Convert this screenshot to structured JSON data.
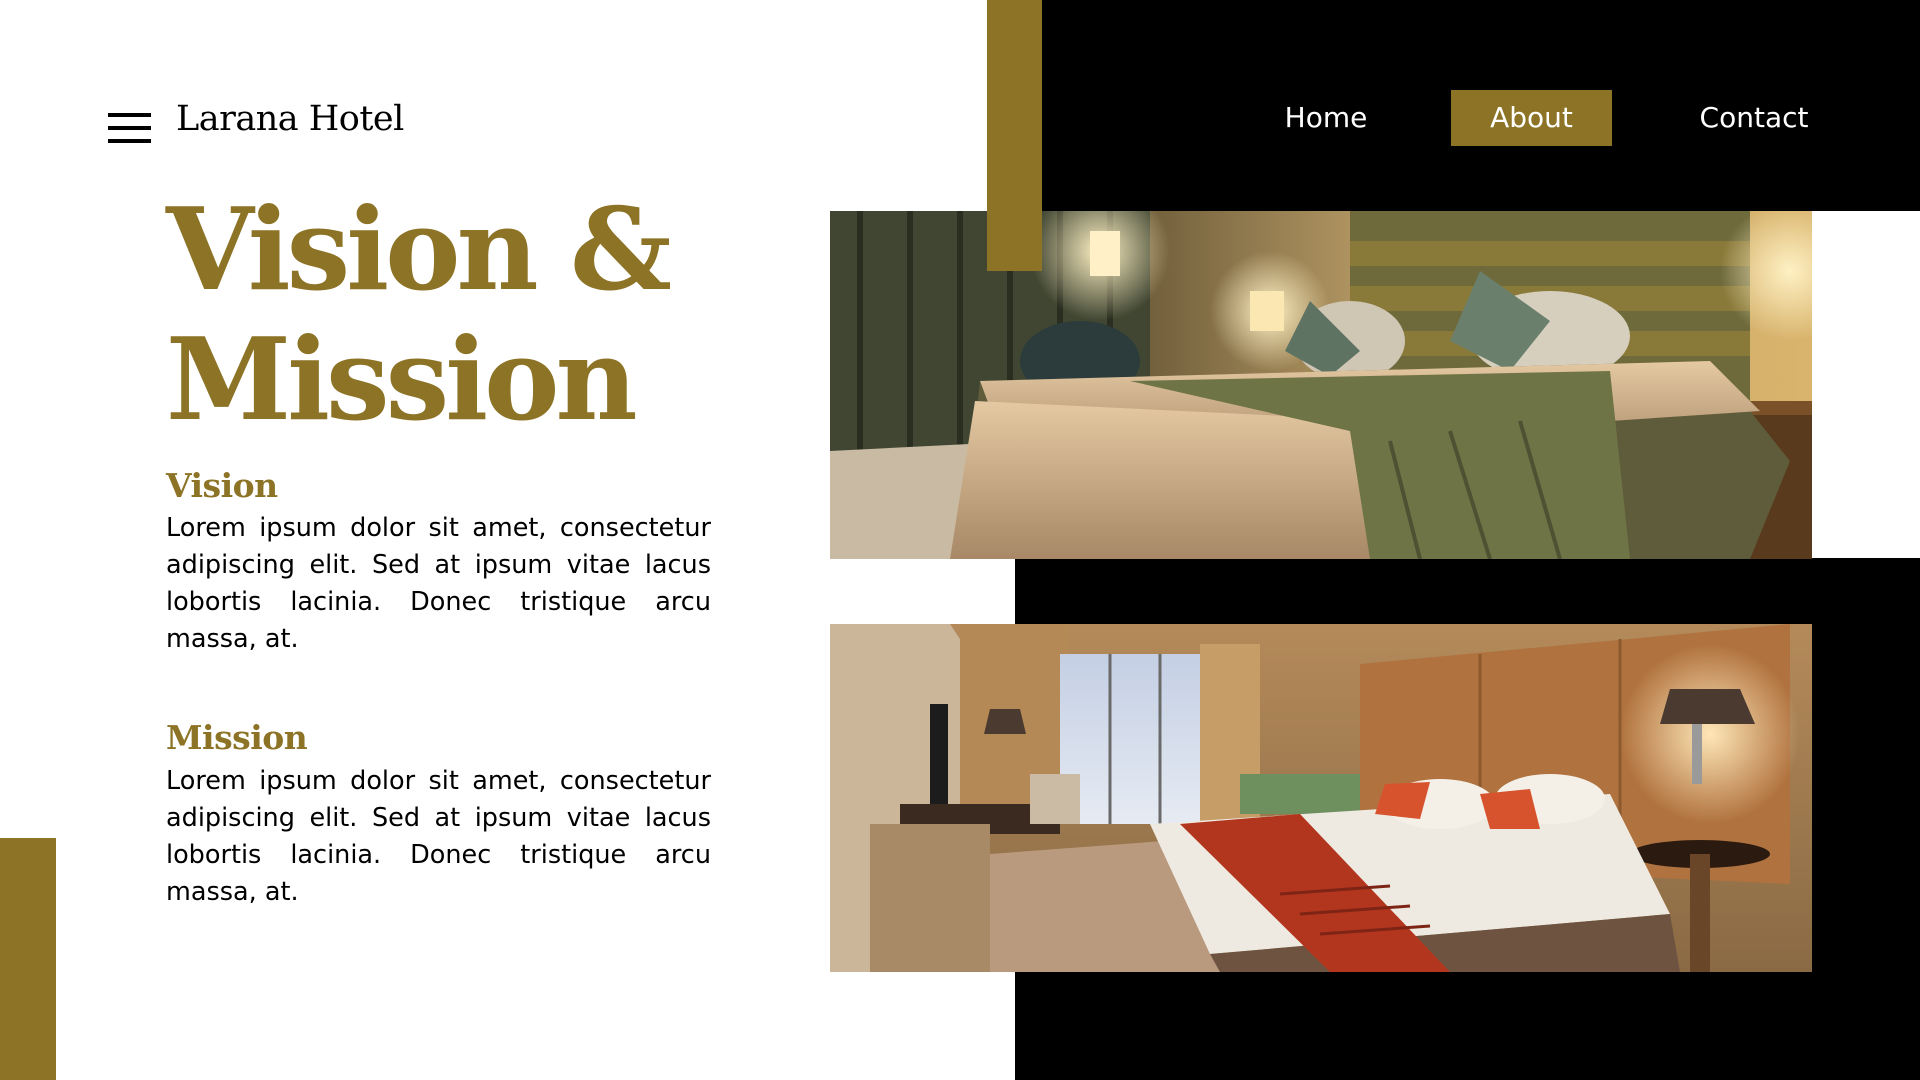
{
  "brand": {
    "name": "Larana Hotel",
    "menu_icon": "hamburger-menu-icon"
  },
  "nav": {
    "items": [
      {
        "label": "Home",
        "active": false
      },
      {
        "label": "About",
        "active": true
      },
      {
        "label": "Contact",
        "active": false
      }
    ]
  },
  "hero": {
    "title_line1": "Vision &",
    "title_line2": "Mission"
  },
  "sections": {
    "vision": {
      "heading": "Vision",
      "body": "Lorem ipsum dolor sit amet, consectetur adipiscing elit. Sed at ipsum vitae lacus lobortis lacinia. Donec tristique arcu massa, at."
    },
    "mission": {
      "heading": "Mission",
      "body": "Lorem ipsum dolor sit amet, consectetur adipiscing elit. Sed at ipsum vitae lacus lobortis lacinia. Donec tristique arcu massa, at."
    }
  },
  "colors": {
    "accent": "#8c7325",
    "dark": "#000000",
    "background": "#ffffff"
  }
}
